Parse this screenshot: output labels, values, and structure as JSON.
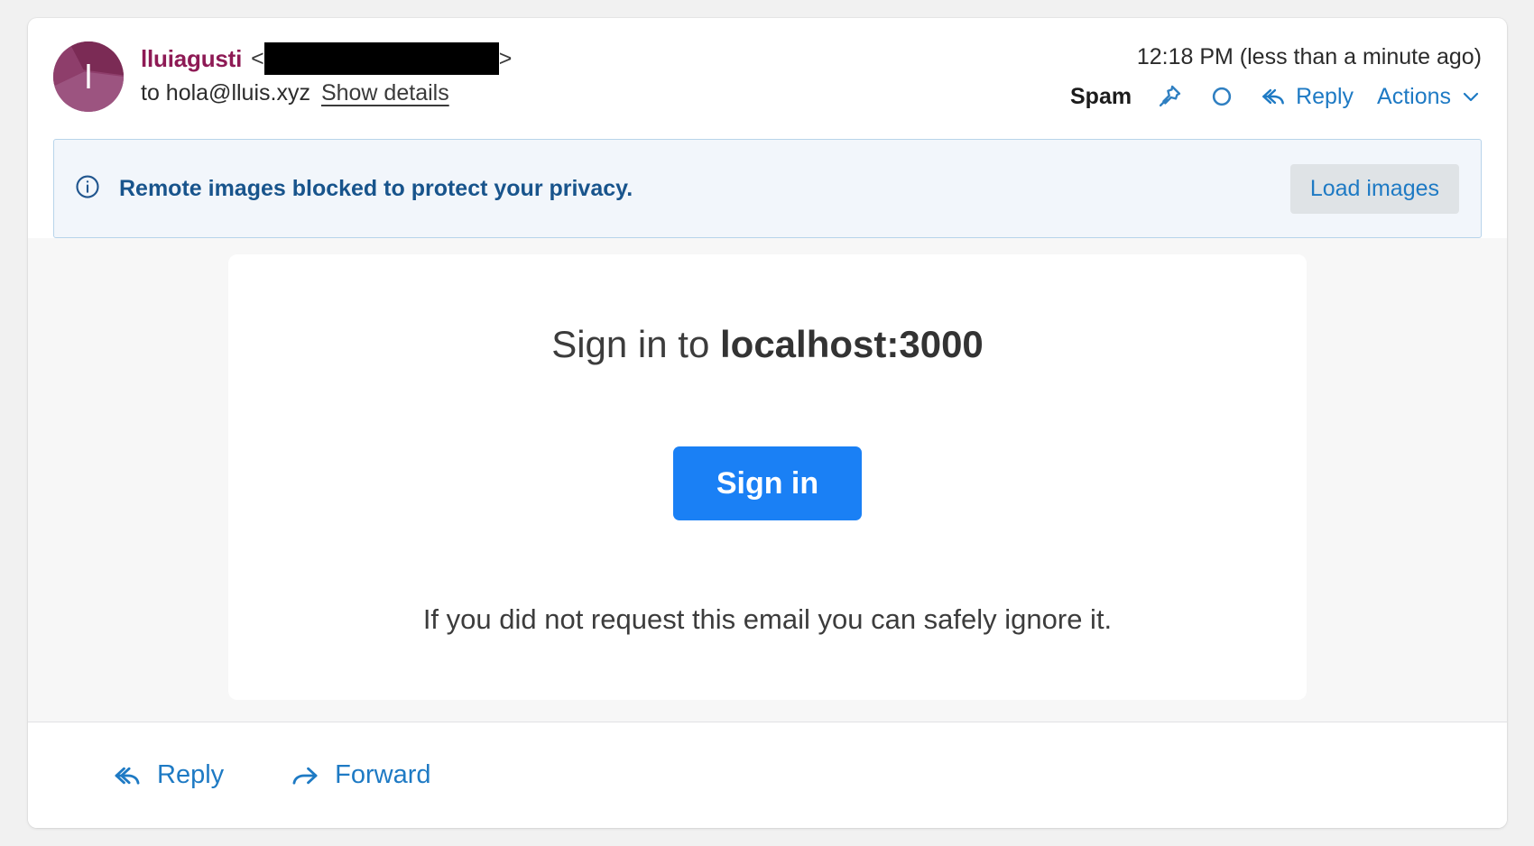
{
  "email": {
    "sender": {
      "name": "lluiagusti",
      "avatar_letter": "l",
      "avatar_color": "#8e3e6b",
      "name_color": "#8e1a55",
      "address_redacted": true,
      "angle_open": "<",
      "angle_close": ">"
    },
    "recipient_line": "to hola@lluis.xyz",
    "show_details_label": "Show details",
    "timestamp": "12:18 PM (less than a minute ago)",
    "header_actions": {
      "spam_label": "Spam",
      "pin_icon": "pin-icon",
      "unread_icon": "circle-unread-icon",
      "reply_label": "Reply",
      "reply_icon": "reply-arrow-icon",
      "actions_label": "Actions",
      "actions_chevron_icon": "chevron-down-icon"
    },
    "images_banner": {
      "info_icon": "info-circle-icon",
      "message": "Remote images blocked to protect your privacy.",
      "button_label": "Load images",
      "background_color": "#f2f6fb",
      "border_color": "#b8d4ea",
      "text_color": "#18548c"
    },
    "body": {
      "heading_prefix": "Sign in to ",
      "heading_host": "localhost:3000",
      "signin_button_label": "Sign in",
      "signin_button_color": "#1a80f5",
      "ignore_notice": "If you did not request this email you can safely ignore it."
    },
    "footer": {
      "reply_label": "Reply",
      "reply_icon": "reply-arrow-icon",
      "forward_label": "Forward",
      "forward_icon": "forward-arrow-icon",
      "link_color": "#1e7ac4"
    }
  }
}
